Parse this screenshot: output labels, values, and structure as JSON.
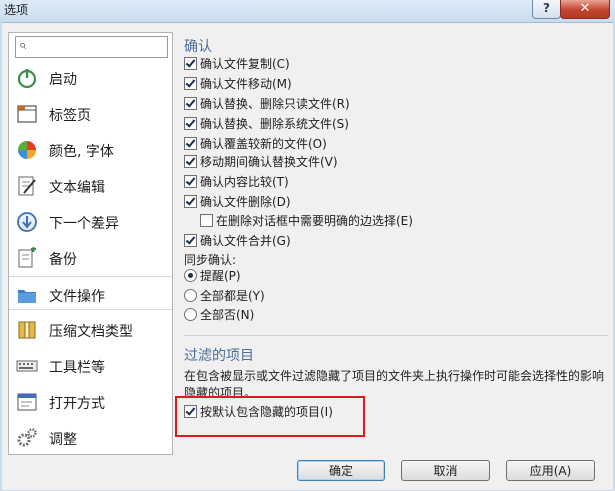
{
  "window": {
    "title": "选项",
    "help_label": "?",
    "close_label": "✕"
  },
  "search": {
    "placeholder": "",
    "icon": "search-icon"
  },
  "sidebar": {
    "items": [
      {
        "label": "启动",
        "icon": "power-icon"
      },
      {
        "label": "标签页",
        "icon": "tabs-icon"
      },
      {
        "label": "颜色, 字体",
        "icon": "palette-icon"
      },
      {
        "label": "文本编辑",
        "icon": "text-edit-icon"
      },
      {
        "label": "下一个差异",
        "icon": "next-diff-icon"
      },
      {
        "label": "备份",
        "icon": "backup-icon"
      },
      {
        "label": "文件操作",
        "icon": "file-operations-icon",
        "selected": true
      },
      {
        "label": "压缩文档类型",
        "icon": "archive-icon"
      },
      {
        "label": "工具栏等",
        "icon": "toolbar-icon"
      },
      {
        "label": "打开方式",
        "icon": "open-with-icon"
      },
      {
        "label": "调整",
        "icon": "tweak-gears-icon"
      }
    ]
  },
  "confirm": {
    "title": "确认",
    "items": [
      {
        "label": "确认文件复制(C)",
        "checked": true
      },
      {
        "label": "确认文件移动(M)",
        "checked": true
      },
      {
        "label": "确认替换、删除只读文件(R)",
        "checked": true
      },
      {
        "label": "确认替换、删除系统文件(S)",
        "checked": true
      },
      {
        "label": "确认覆盖较新的文件(O)",
        "checked": true
      },
      {
        "label": "移动期间确认替换文件(V)",
        "checked": true
      },
      {
        "label": "确认内容比较(T)",
        "checked": true
      },
      {
        "label": "确认文件删除(D)",
        "checked": true
      },
      {
        "label": "在删除对话框中需要明确的边选择(E)",
        "checked": false
      },
      {
        "label": "确认文件合并(G)",
        "checked": true
      }
    ],
    "sync_label": "同步确认:",
    "sync_options": [
      {
        "label": "提醒(P)",
        "selected": true
      },
      {
        "label": "全部都是(Y)",
        "selected": false
      },
      {
        "label": "全部否(N)",
        "selected": false
      }
    ]
  },
  "filter": {
    "title": "过滤的项目",
    "description": "在包含被显示或文件过滤隐藏了项目的文件夹上执行操作时可能会选择性的影响隐藏的项目。",
    "include_hidden_label": "按默认包含隐藏的项目(I)",
    "include_hidden_checked": true
  },
  "buttons": {
    "ok": "确定",
    "cancel": "取消",
    "apply": "应用(A)"
  },
  "colors": {
    "accent_heading": "#4a6d9a",
    "highlight_box": "#e0191f",
    "close_button": "#c2442f"
  }
}
